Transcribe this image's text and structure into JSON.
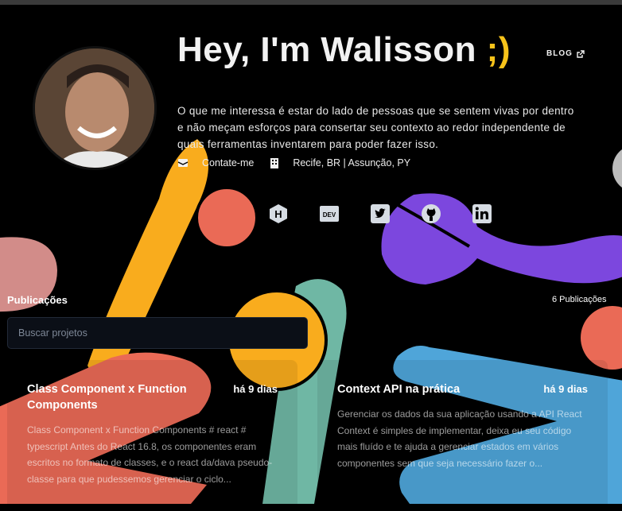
{
  "header": {
    "title_main": "Hey, I'm Walisson ",
    "title_smile": ";)",
    "blog_label": "BLOG",
    "bio": "O que me interessa é estar do lado de pessoas que se sentem vivas por dentro e não meçam esforços para consertar seu contexto ao redor independente de quais ferramentas inventarem para poder fazer isso.",
    "contact_label": "Contate-me",
    "location_label": "Recife, BR | Assunção, PY"
  },
  "social": [
    "hashnode-icon",
    "dev-icon",
    "twitter-icon",
    "github-icon",
    "linkedin-icon"
  ],
  "publications": {
    "title": "Publicações",
    "count_label": "6 Publicações",
    "search_placeholder": "Buscar projetos",
    "cards": [
      {
        "title": "Class Component x Function Components",
        "date": "há 9 dias",
        "description": "Class Component x Function Components # react # typescript Antes do React 16.8, os componentes eram escritos no formato de classes, e o react da/dava pseudo-classe para que pudessemos gerenciar o ciclo..."
      },
      {
        "title": "Context API na prática",
        "date": "há 9 dias",
        "description": "Gerenciar os dados da sua aplicação usando a API React Context é simples de implementar, deixa eu seu código mais fluído e te ajuda a gerenciar estados em vários componentes sem que seja necessário fazer o..."
      }
    ]
  },
  "colors": {
    "background": "#000000",
    "yellow": "#f9ac1d",
    "coral": "#ea6a56",
    "purple": "#7c47de",
    "teal": "#6fb7a4",
    "blue": "#4fa5d9",
    "pink": "#e99b98",
    "accent_smile": "#f7c31a"
  }
}
